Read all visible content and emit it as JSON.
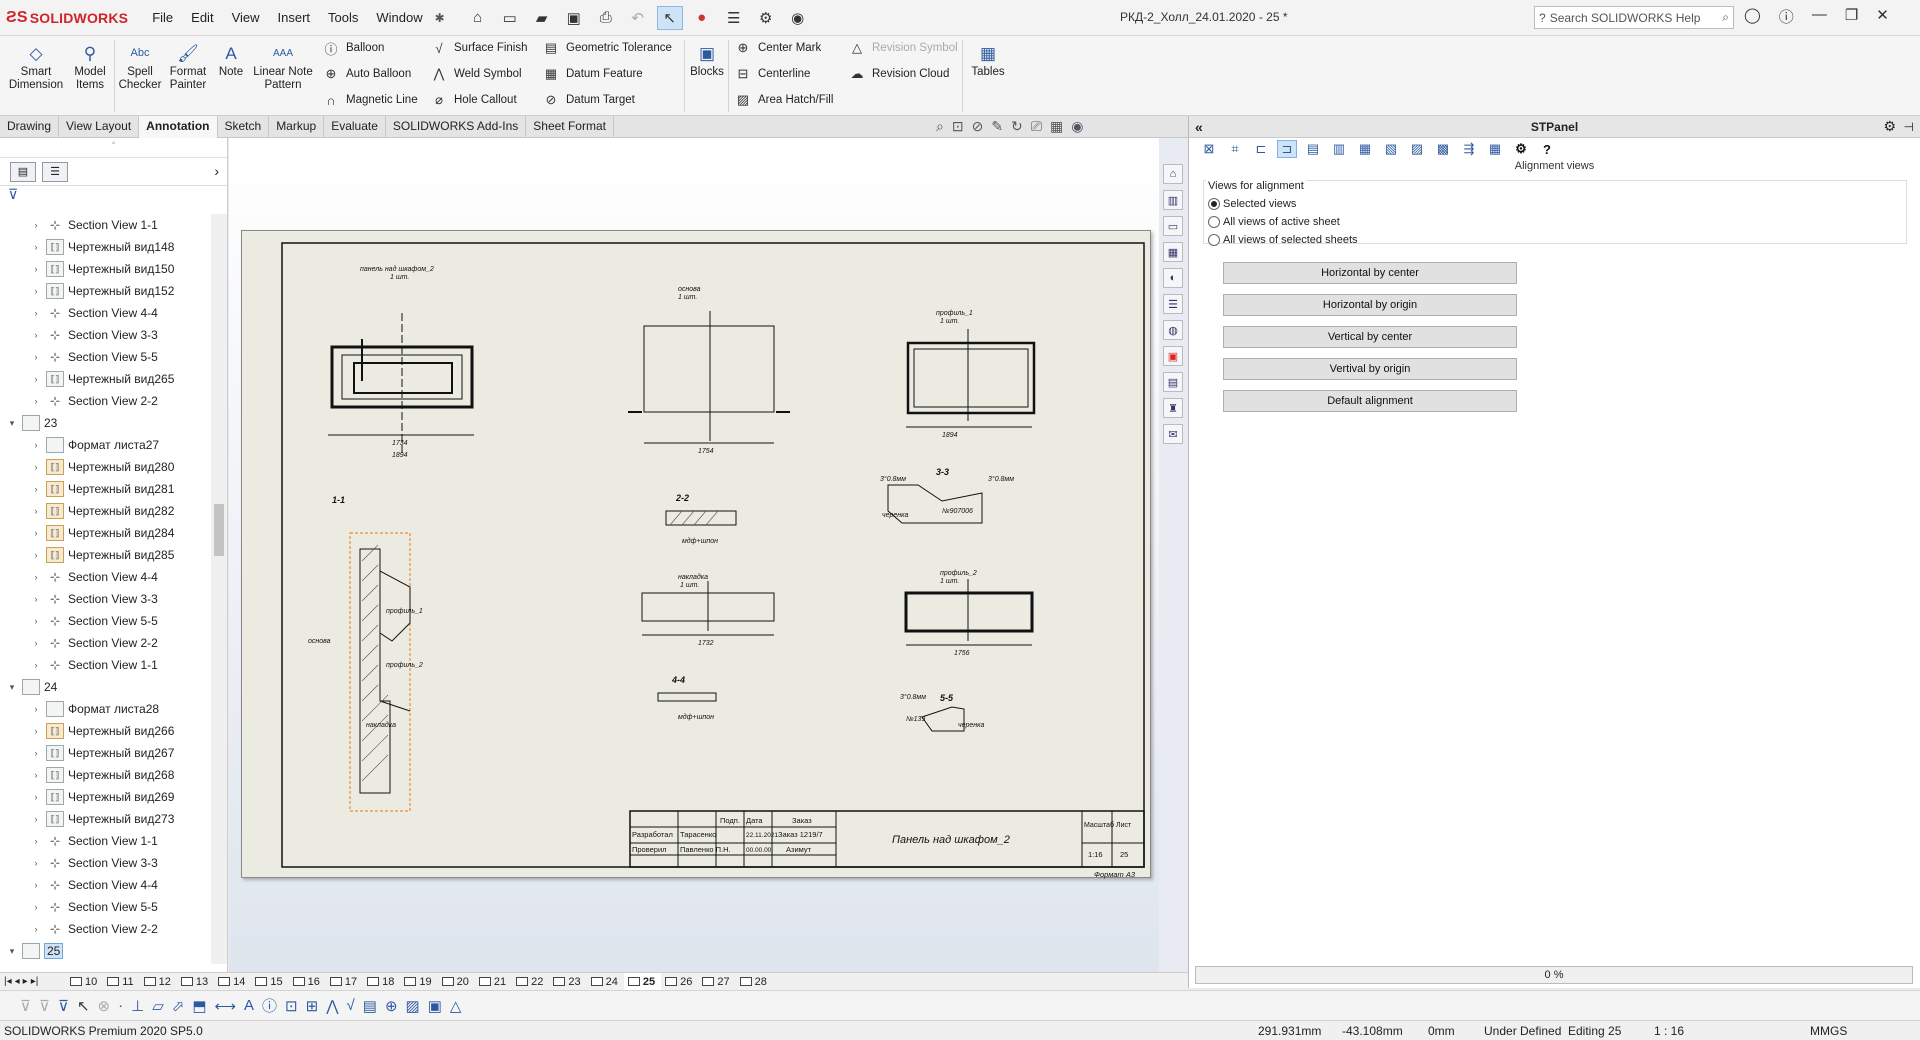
{
  "app": {
    "name": "SOLIDWORKS",
    "document_title": "РКД-2_Холл_24.01.2020 - 25 *",
    "search_placeholder": "Search SOLIDWORKS Help"
  },
  "menu": [
    "File",
    "Edit",
    "View",
    "Insert",
    "Tools",
    "Window"
  ],
  "ribbon": {
    "smart_dimension": "Smart Dimension",
    "model_items": "Model Items",
    "spell_checker": "Spell Checker",
    "format_painter": "Format Painter",
    "note": "Note",
    "linear_note_pattern": "Linear Note Pattern",
    "balloon": "Balloon",
    "auto_balloon": "Auto Balloon",
    "magnetic_line": "Magnetic Line",
    "surface_finish": "Surface Finish",
    "weld_symbol": "Weld Symbol",
    "hole_callout": "Hole Callout",
    "geometric_tolerance": "Geometric Tolerance",
    "datum_feature": "Datum Feature",
    "datum_target": "Datum Target",
    "blocks": "Blocks",
    "center_mark": "Center Mark",
    "centerline": "Centerline",
    "area_hatch": "Area Hatch/Fill",
    "revision_symbol": "Revision Symbol",
    "revision_cloud": "Revision Cloud",
    "tables": "Tables"
  },
  "tabs": [
    "Drawing",
    "View Layout",
    "Annotation",
    "Sketch",
    "Markup",
    "Evaluate",
    "SOLIDWORKS Add-Ins",
    "Sheet Format"
  ],
  "active_tab": "Annotation",
  "tree": [
    {
      "level": 1,
      "icon": "sec",
      "label": "Section View 1-1"
    },
    {
      "level": 1,
      "icon": "view",
      "label": "Чертежный вид148"
    },
    {
      "level": 1,
      "icon": "view",
      "label": "Чертежный вид150"
    },
    {
      "level": 1,
      "icon": "view",
      "label": "Чертежный вид152"
    },
    {
      "level": 1,
      "icon": "sec",
      "label": "Section View 4-4"
    },
    {
      "level": 1,
      "icon": "sec",
      "label": "Section View 3-3"
    },
    {
      "level": 1,
      "icon": "sec",
      "label": "Section View 5-5"
    },
    {
      "level": 1,
      "icon": "view",
      "label": "Чертежный вид265"
    },
    {
      "level": 1,
      "icon": "sec",
      "label": "Section View 2-2"
    },
    {
      "level": 0,
      "icon": "sheet",
      "label": "23"
    },
    {
      "level": 1,
      "icon": "fmt",
      "label": "Формат листа27"
    },
    {
      "level": 1,
      "icon": "img",
      "label": "Чертежный вид280"
    },
    {
      "level": 1,
      "icon": "img",
      "label": "Чертежный вид281"
    },
    {
      "level": 1,
      "icon": "img",
      "label": "Чертежный вид282"
    },
    {
      "level": 1,
      "icon": "img",
      "label": "Чертежный вид284"
    },
    {
      "level": 1,
      "icon": "img",
      "label": "Чертежный вид285"
    },
    {
      "level": 1,
      "icon": "sec",
      "label": "Section View 4-4"
    },
    {
      "level": 1,
      "icon": "sec",
      "label": "Section View 3-3"
    },
    {
      "level": 1,
      "icon": "sec",
      "label": "Section View 5-5"
    },
    {
      "level": 1,
      "icon": "sec",
      "label": "Section View 2-2"
    },
    {
      "level": 1,
      "icon": "sec",
      "label": "Section View 1-1"
    },
    {
      "level": 0,
      "icon": "sheet",
      "label": "24"
    },
    {
      "level": 1,
      "icon": "fmt",
      "label": "Формат листа28"
    },
    {
      "level": 1,
      "icon": "img",
      "label": "Чертежный вид266"
    },
    {
      "level": 1,
      "icon": "view",
      "label": "Чертежный вид267"
    },
    {
      "level": 1,
      "icon": "view",
      "label": "Чертежный вид268"
    },
    {
      "level": 1,
      "icon": "view",
      "label": "Чертежный вид269"
    },
    {
      "level": 1,
      "icon": "view",
      "label": "Чертежный вид273"
    },
    {
      "level": 1,
      "icon": "sec",
      "label": "Section View 1-1"
    },
    {
      "level": 1,
      "icon": "sec",
      "label": "Section View 3-3"
    },
    {
      "level": 1,
      "icon": "sec",
      "label": "Section View 4-4"
    },
    {
      "level": 1,
      "icon": "sec",
      "label": "Section View 5-5"
    },
    {
      "level": 1,
      "icon": "sec",
      "label": "Section View 2-2"
    },
    {
      "level": 0,
      "icon": "sheet",
      "label": "25",
      "selected": true
    }
  ],
  "drawing": {
    "title_top": "панель над шкафом_2",
    "qty": "1 шт.",
    "osnova": "основа",
    "profil1": "профиль_1",
    "profil2": "профиль_2",
    "nakladka": "накладка",
    "sec11": "1-1",
    "sec22": "2-2",
    "sec33": "3-3",
    "sec44": "4-4",
    "sec55": "5-5",
    "mdf": "мдф+шпон",
    "cherenka": "черенка",
    "no907": "№907006",
    "no139": "№139",
    "chamfer": "3°0.8мм",
    "d1": "1734",
    "d2": "1894",
    "d3": "1754",
    "d4": "1732",
    "d5": "1756",
    "stamp": {
      "razrab": "Разработал",
      "razrab_name": "Тарасенко",
      "prover": "Проверил",
      "prover_name": "Павленко П.Н.",
      "podp": "Подп.",
      "data": "Дата",
      "date1": "22.11.2021",
      "date2": "00.00.00",
      "zakaz": "Заказ",
      "zakaz_val": "Заказ 1219/7",
      "azimut": "Азимут",
      "name": "Панель над шкафом_2",
      "masshtab": "Масштаб",
      "list": "Лист",
      "scale": "1:16",
      "sheet_no": "25",
      "format": "Формат А3"
    }
  },
  "stpanel": {
    "title": "STPanel",
    "subtitle": "Alignment views",
    "group_label": "Views for alignment",
    "options": [
      "Selected views",
      "All views of active sheet",
      "All views of selected sheets"
    ],
    "selected_option": 0,
    "buttons": [
      "Horizontal by center",
      "Horizontal by origin",
      "Vertical by center",
      "Vertival by origin",
      "Default alignment"
    ],
    "progress_text": "0 %",
    "progress_value": 0
  },
  "sheet_tabs": [
    "10",
    "11",
    "12",
    "13",
    "14",
    "15",
    "16",
    "17",
    "18",
    "19",
    "20",
    "21",
    "22",
    "23",
    "24",
    "25",
    "26",
    "27",
    "28"
  ],
  "active_sheet": "25",
  "status": {
    "product": "SOLIDWORKS Premium 2020 SP5.0",
    "x": "291.931mm",
    "y": "-43.108mm",
    "z": "0mm",
    "state": "Under Defined",
    "editing": "Editing 25",
    "scale": "1 : 16",
    "units": "MMGS"
  }
}
